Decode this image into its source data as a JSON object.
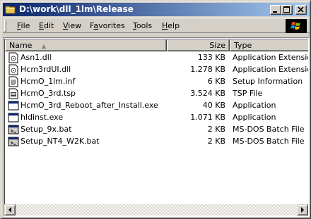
{
  "window": {
    "title": "D:\\work\\dll_1lm\\Release"
  },
  "menu": [
    {
      "label": "File",
      "hotkey": "F",
      "rest": "ile"
    },
    {
      "label": "Edit",
      "hotkey": "E",
      "rest": "dit"
    },
    {
      "label": "View",
      "hotkey": "V",
      "rest": "iew"
    },
    {
      "label": "Favorites",
      "hotkey": "",
      "pre": "F",
      "hk2": "a",
      "rest": "vorites"
    },
    {
      "label": "Tools",
      "hotkey": "T",
      "rest": "ools"
    },
    {
      "label": "Help",
      "hotkey": "H",
      "rest": "elp"
    }
  ],
  "columns": {
    "name": "Name",
    "size": "Size",
    "type": "Type",
    "sort_indicator": "▲"
  },
  "files": [
    {
      "name": "Asn1.dll",
      "size": "133 KB",
      "type": "Application Extension",
      "icon": "dll-file-icon"
    },
    {
      "name": "Hcm3rdUI.dll",
      "size": "1.278 KB",
      "type": "Application Extension",
      "icon": "dll-file-icon"
    },
    {
      "name": "HcmO_1lm.inf",
      "size": "6 KB",
      "type": "Setup Information",
      "icon": "inf-file-icon"
    },
    {
      "name": "HcmO_3rd.tsp",
      "size": "3.524 KB",
      "type": "TSP File",
      "icon": "tsp-file-icon"
    },
    {
      "name": "HcmO_3rd_Reboot_after_Install.exe",
      "size": "40 KB",
      "type": "Application",
      "icon": "exe-application-icon"
    },
    {
      "name": "hldinst.exe",
      "size": "1.071 KB",
      "type": "Application",
      "icon": "exe-application-icon"
    },
    {
      "name": "Setup_9x.bat",
      "size": "2 KB",
      "type": "MS-DOS Batch File",
      "icon": "batch-file-icon"
    },
    {
      "name": "Setup_NT4_W2K.bat",
      "size": "2 KB",
      "type": "MS-DOS Batch File",
      "icon": "batch-file-icon"
    }
  ],
  "colors": {
    "titlebar_start": "#0a246a",
    "titlebar_end": "#a6caf0",
    "face": "#d4d0c8"
  }
}
